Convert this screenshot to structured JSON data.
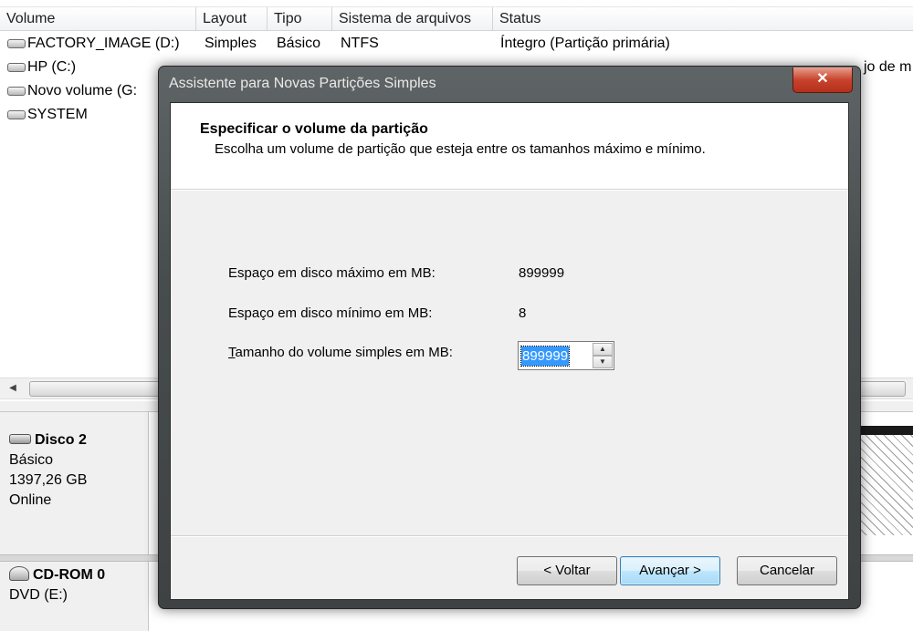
{
  "volume_list": {
    "columns": [
      "Volume",
      "Layout",
      "Tipo",
      "Sistema de arquivos",
      "Status"
    ],
    "rows": [
      {
        "volume": "FACTORY_IMAGE (D:)",
        "layout": "Simples",
        "type": "Básico",
        "fs": "NTFS",
        "status": "Íntegro (Partição primária)"
      },
      {
        "volume": "HP (C:)",
        "layout": "",
        "type": "",
        "fs": "",
        "status": ""
      },
      {
        "volume": "Novo volume (G:",
        "layout": "",
        "type": "",
        "fs": "",
        "status": ""
      },
      {
        "volume": "SYSTEM",
        "layout": "",
        "type": "",
        "fs": "",
        "status": ""
      }
    ],
    "status_tail": "jo de m"
  },
  "disks": [
    {
      "name": "Disco 2",
      "type": "Básico",
      "size": "1397,26 GB",
      "state": "Online"
    },
    {
      "name": "CD-ROM 0",
      "type": "DVD (E:)"
    }
  ],
  "dialog": {
    "title": "Assistente para Novas Partições Simples",
    "close_glyph": "✕",
    "header_title": "Especificar o volume da partição",
    "header_subtitle": "Escolha um volume de partição que esteja entre os tamanhos máximo e mínimo.",
    "max_label": "Espaço em disco máximo em MB:",
    "max_value": "899999",
    "min_label": "Espaço em disco mínimo em MB:",
    "min_value": "8",
    "size_label_accel": "T",
    "size_label_rest": "amanho do volume simples em MB:",
    "size_value": "899999",
    "buttons": {
      "back": "< Voltar",
      "next": "Avançar >",
      "cancel": "Cancelar"
    }
  }
}
